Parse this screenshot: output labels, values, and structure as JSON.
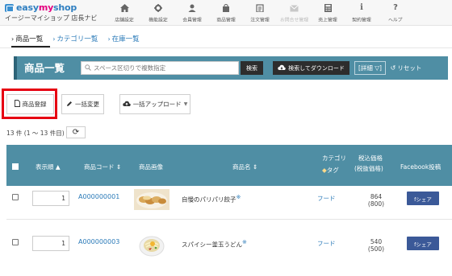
{
  "app": {
    "logo_brand_prefix": "easy",
    "logo_brand_mid": "my",
    "logo_brand_suffix": "shop",
    "logo_subtitle": "イージーマイショップ 店長ナビ"
  },
  "topnav": [
    {
      "label": "店舗設定",
      "icon": "home-icon",
      "dim": false
    },
    {
      "label": "機能設定",
      "icon": "gear-icon",
      "dim": false
    },
    {
      "label": "会員管理",
      "icon": "user-icon",
      "dim": false
    },
    {
      "label": "商品管理",
      "icon": "bag-icon",
      "dim": false
    },
    {
      "label": "注文管理",
      "icon": "clipboard-icon",
      "dim": false
    },
    {
      "label": "お問合せ管理",
      "icon": "mail-icon",
      "dim": true
    },
    {
      "label": "売上管理",
      "icon": "calculator-icon",
      "dim": false
    },
    {
      "label": "契約管理",
      "icon": "info-icon",
      "dim": false
    },
    {
      "label": "ヘルプ",
      "icon": "question-icon",
      "dim": false
    }
  ],
  "subtabs": [
    {
      "label": "商品一覧",
      "active": true
    },
    {
      "label": "カテゴリ一覧",
      "active": false
    },
    {
      "label": "在庫一覧",
      "active": false
    }
  ],
  "header": {
    "title": "商品一覧",
    "search_placeholder": "スペース区切りで複数指定",
    "search_button": "検索",
    "download_button": "検索してダウンロード",
    "detail_button": "[詳細 ▽]",
    "reset_button": "リセット"
  },
  "actions": {
    "register": "商品登録",
    "bulk_edit": "一括変更",
    "bulk_upload": "一括アップロード"
  },
  "count_text": "13 件 (1 ～ 13 件目)",
  "table": {
    "headers": {
      "order": "表示順",
      "code": "商品コード",
      "image": "商品画像",
      "name": "商品名",
      "category": "カテゴリ",
      "tag": "タグ",
      "price": "税込価格",
      "price_sub": "(税抜価格)",
      "facebook": "Facebook投稿"
    },
    "rows": [
      {
        "order": "1",
        "code": "A000000001",
        "name": "自慢のパリパリ餃子",
        "category": "フード",
        "price": "864",
        "price_ex": "(800)",
        "fb": "fシェア"
      },
      {
        "order": "1",
        "code": "A000000003",
        "name": "スパイシー釜玉うどん",
        "category": "フード",
        "price": "540",
        "price_ex": "(500)",
        "fb": "fシェア"
      }
    ]
  },
  "colors": {
    "header_bg": "#4f8ea4",
    "link": "#2a7ab8",
    "highlight": "#e60012",
    "facebook": "#3b5998"
  }
}
